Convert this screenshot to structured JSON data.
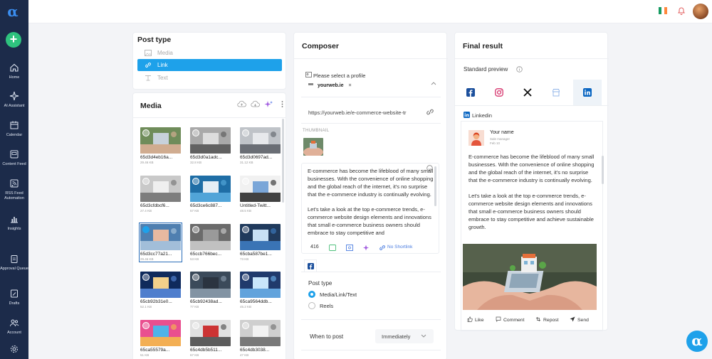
{
  "sidebar": {
    "items": [
      {
        "label": "Home",
        "icon": "home-icon"
      },
      {
        "label": "AI Assistant",
        "icon": "ai-sparkle-icon"
      },
      {
        "label": "Calendar",
        "icon": "calendar-icon"
      },
      {
        "label": "Content Feed",
        "icon": "feed-icon"
      },
      {
        "label": "RSS Feed Automation",
        "icon": "rss-icon"
      },
      {
        "label": "Insights",
        "icon": "chart-icon"
      },
      {
        "label": "Approval Queue",
        "icon": "clipboard-icon"
      },
      {
        "label": "Drafts",
        "icon": "draft-icon"
      },
      {
        "label": "Account",
        "icon": "users-icon"
      },
      {
        "label": "",
        "icon": "gear-icon"
      }
    ],
    "add_label": "+",
    "logo_glyph": "α"
  },
  "colors": {
    "sidebar_bg": "#1c2b4a",
    "accent": "#1ea1ea",
    "add_green": "#2ec27e",
    "linkedin": "#0a66c2"
  },
  "post_type": {
    "title": "Post type",
    "options": [
      {
        "label": "Media",
        "icon": "image-icon",
        "active": false
      },
      {
        "label": "Link",
        "icon": "link-icon",
        "active": true
      },
      {
        "label": "Text",
        "icon": "text-icon",
        "active": false
      }
    ]
  },
  "media": {
    "title": "Media",
    "items": [
      {
        "name": "65d3d4eb16a...",
        "size": "29.46 KB"
      },
      {
        "name": "65d3d0a1adc...",
        "size": "32.8 KB"
      },
      {
        "name": "65d3d0697ad...",
        "size": "31.12 KB"
      },
      {
        "name": "65d3cfdbcf6...",
        "size": "27.4 KB"
      },
      {
        "name": "65d3ce6c887...",
        "size": "57 KB"
      },
      {
        "name": "Untitled-Twitt...",
        "size": "48.5 KB"
      },
      {
        "name": "65d3cc77a21...",
        "size": "29.46 KB",
        "selected": true
      },
      {
        "name": "65ccb766bec...",
        "size": "53 KB"
      },
      {
        "name": "65cba587be1...",
        "size": "73 KB"
      },
      {
        "name": "65cb92b31e0...",
        "size": "52.1 KB"
      },
      {
        "name": "65cb92438ad...",
        "size": "77 KB"
      },
      {
        "name": "65ca9564ddb...",
        "size": "45.2 KB"
      },
      {
        "name": "65ca55579a...",
        "size": "51 KB"
      },
      {
        "name": "65c4db5b511...",
        "size": "67 KB"
      },
      {
        "name": "65c4db3038...",
        "size": "47 KB"
      }
    ]
  },
  "composer": {
    "title": "Composer",
    "profile_label": "Please select a profile",
    "profile_chip": "yourweb.ie",
    "chip_remove": "×",
    "url": "https://yourweb.ie/e-commerce-website-tr",
    "thumbnail_label": "THUMBNAIL",
    "text_p1": "E-commerce has become the lifeblood of many small businesses. With the convenience of online shopping and the global reach of the internet, it's no surprise that the e-commerce industry is continually evolving.",
    "text_p2": "Let's take a look at the top e-commerce trends, e-commerce website design elements and innovations that small e-commerce business owners should embrace to stay competitive and",
    "char_count": "416",
    "shortlink": "No Shortlink",
    "post_type_title": "Post type",
    "post_type_options": [
      {
        "label": "Media/Link/Text",
        "checked": true
      },
      {
        "label": "Reels",
        "checked": false
      }
    ],
    "when_label": "When to post",
    "when_value": "Immediately"
  },
  "final": {
    "title": "Final result",
    "standard_preview": "Standard preview",
    "networks": [
      "facebook-icon",
      "instagram-icon",
      "x-icon",
      "gmb-icon",
      "linkedin-icon"
    ],
    "active_network": "linkedin-icon",
    "network_label": "Linkedin",
    "card": {
      "name": "Your name",
      "role": "Sale manager",
      "date": "Feb 10",
      "p1": "E-commerce has become the lifeblood of many small businesses. With the convenience of online shopping and the global reach of the internet, it's no surprise that the e-commerce industry is continually evolving.",
      "p2": "Let's take a look at the top e-commerce trends, e-commerce website design elements and innovations that small e-commerce business owners should embrace to stay competitive and achieve sustainable growth.",
      "actions": [
        "Like",
        "Comment",
        "Repost",
        "Send"
      ]
    }
  },
  "chat_glyph": "α"
}
